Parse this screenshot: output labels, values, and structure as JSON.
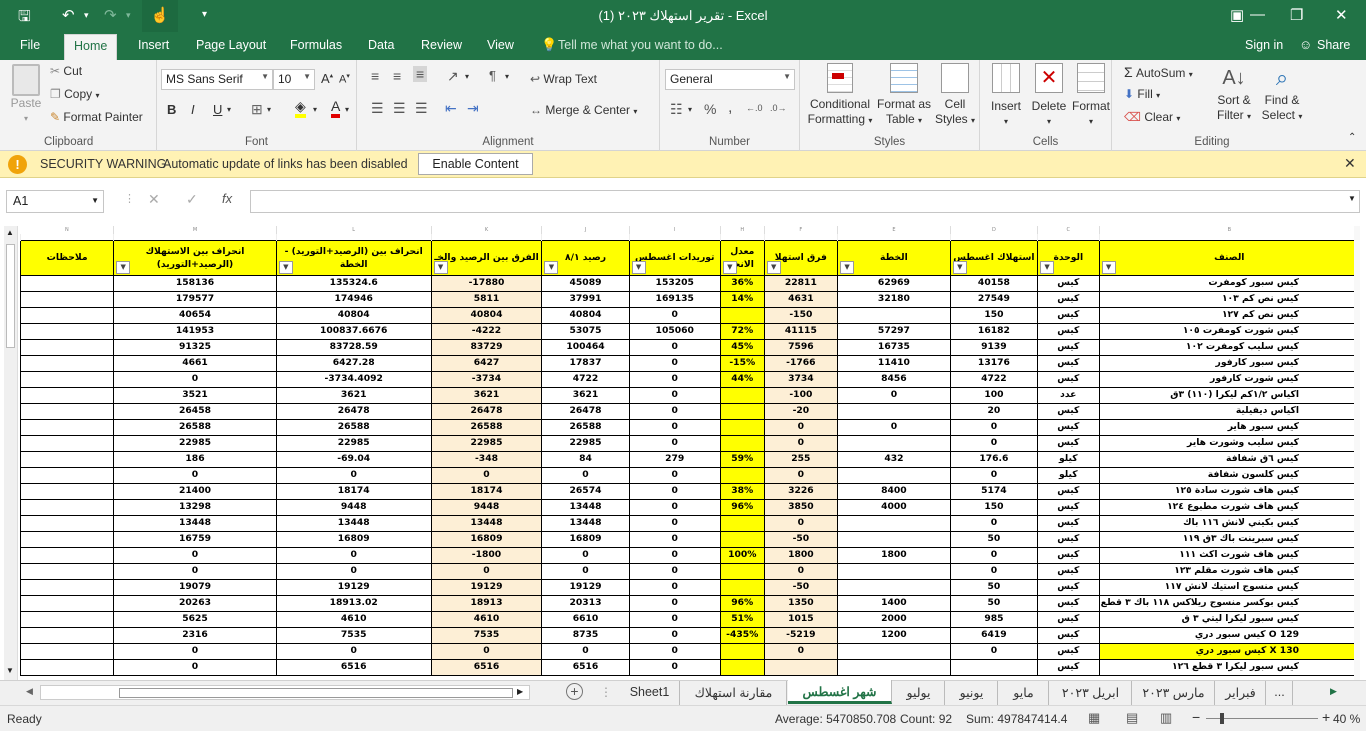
{
  "window": {
    "title": "تقرير استهلاك ٢٠٢٣ (1) - Excel"
  },
  "ribbon_tabs": [
    "File",
    "Home",
    "Insert",
    "Page Layout",
    "Formulas",
    "Data",
    "Review",
    "View"
  ],
  "tell_me": "Tell me what you want to do...",
  "account": {
    "signin": "Sign in",
    "share": "Share"
  },
  "clipboard": {
    "paste": "Paste",
    "cut": "Cut",
    "copy": "Copy",
    "format_painter": "Format Painter",
    "label": "Clipboard"
  },
  "font": {
    "name": "MS Sans Serif",
    "size": "10",
    "bold": "B",
    "italic": "I",
    "underline": "U",
    "label": "Font"
  },
  "alignment": {
    "wrap": "Wrap Text",
    "merge": "Merge & Center",
    "label": "Alignment"
  },
  "number": {
    "format": "General",
    "label": "Number"
  },
  "styles": {
    "cond": "Conditional",
    "cond2": "Formatting",
    "fmt_table": "Format as",
    "fmt_table2": "Table",
    "cell_styles": "Cell",
    "cell_styles2": "Styles",
    "label": "Styles"
  },
  "cells": {
    "insert": "Insert",
    "delete": "Delete",
    "format": "Format",
    "label": "Cells"
  },
  "editing": {
    "autosum": "AutoSum",
    "fill": "Fill",
    "clear": "Clear",
    "sort": "Sort &",
    "sort2": "Filter",
    "find": "Find &",
    "find2": "Select",
    "label": "Editing"
  },
  "security": {
    "title": "SECURITY WARNING",
    "message": "Automatic update of links has been disabled",
    "button": "Enable Content"
  },
  "namebox": "A1",
  "col_letters": [
    "N",
    "M",
    "L",
    "K",
    "J",
    "I",
    "H",
    "F",
    "E",
    "D",
    "C",
    "B"
  ],
  "headers": [
    "ملاحظات",
    "انحراف بين الاستهلاك (الرصيد+التوريد)",
    "انحراف بين (الرصيد+التوريد) - الخطة",
    "الفرق بين الرصيد والخـ",
    "رصيد ٨/١",
    "توريدات اغسطس",
    "معدل الانحـ",
    "فرق استهلا",
    "الخطة",
    "استهلاك اغسطس",
    "الوحدة",
    "الصنف"
  ],
  "rows": [
    [
      "",
      "158136",
      "135324.6",
      "-17880",
      "45089",
      "153205",
      "36%",
      "22811",
      "62969",
      "40158",
      "كيس",
      "كيس سبور كومفرت"
    ],
    [
      "",
      "179577",
      "174946",
      "5811",
      "37991",
      "169135",
      "14%",
      "4631",
      "32180",
      "27549",
      "كيس",
      "كيس نص كم ١٠٣"
    ],
    [
      "",
      "40654",
      "40804",
      "40804",
      "40804",
      "0",
      "",
      "-150",
      "",
      "150",
      "كيس",
      "كيس نص كم ١٢٧"
    ],
    [
      "",
      "141953",
      "100837.6676",
      "-4222",
      "53075",
      "105060",
      "72%",
      "41115",
      "57297",
      "16182",
      "كيس",
      "كيس شورت كومفرت ١٠٥"
    ],
    [
      "",
      "91325",
      "83728.59",
      "83729",
      "100464",
      "0",
      "45%",
      "7596",
      "16735",
      "9139",
      "كيس",
      "كيس سليب كومفرت ١٠٢"
    ],
    [
      "",
      "4661",
      "6427.28",
      "6427",
      "17837",
      "0",
      "-15%",
      "-1766",
      "11410",
      "13176",
      "كيس",
      "كيس سبور كارفور"
    ],
    [
      "",
      "0",
      "-3734.4092",
      "-3734",
      "4722",
      "0",
      "44%",
      "3734",
      "8456",
      "4722",
      "كيس",
      "كيس شورت كارفور"
    ],
    [
      "",
      "3521",
      "3621",
      "3621",
      "3621",
      "0",
      "",
      "-100",
      "0",
      "100",
      "عدد",
      "اكياس ١/٢كم ليكرا (١١٠) ٣ق"
    ],
    [
      "",
      "26458",
      "26478",
      "26478",
      "26478",
      "0",
      "",
      "-20",
      "",
      "20",
      "كيس",
      "اكياس ديفيلية"
    ],
    [
      "",
      "26588",
      "26588",
      "26588",
      "26588",
      "0",
      "",
      "0",
      "0",
      "0",
      "كيس",
      "كيس سبور هاير"
    ],
    [
      "",
      "22985",
      "22985",
      "22985",
      "22985",
      "0",
      "",
      "0",
      "",
      "0",
      "كيس",
      "كيس سليب وشورت هاير"
    ],
    [
      "",
      "186",
      "-69.04",
      "-348",
      "84",
      "279",
      "59%",
      "255",
      "432",
      "176.6",
      "كيلو",
      "كيس ٦ق شفافة"
    ],
    [
      "",
      "0",
      "0",
      "0",
      "0",
      "0",
      "",
      "0",
      "",
      "0",
      "كيلو",
      "كيس كلسون شفافة"
    ],
    [
      "",
      "21400",
      "18174",
      "18174",
      "26574",
      "0",
      "38%",
      "3226",
      "8400",
      "5174",
      "كيس",
      "كيس هاف شورت سادة ١٢٥"
    ],
    [
      "",
      "13298",
      "9448",
      "9448",
      "13448",
      "0",
      "96%",
      "3850",
      "4000",
      "150",
      "كيس",
      "كيس هاف شورت مطبوع ١٢٤"
    ],
    [
      "",
      "13448",
      "13448",
      "13448",
      "13448",
      "0",
      "",
      "0",
      "",
      "0",
      "كيس",
      "كيس بكيني لانش ١١٦ باك"
    ],
    [
      "",
      "16759",
      "16809",
      "16809",
      "16809",
      "0",
      "",
      "-50",
      "",
      "50",
      "كيس",
      "كيس سبرينت باك ٣ق ١١٩"
    ],
    [
      "",
      "0",
      "0",
      "-1800",
      "0",
      "0",
      "100%",
      "1800",
      "1800",
      "0",
      "كيس",
      "كيس هاف شورت اكث ١١١"
    ],
    [
      "",
      "0",
      "0",
      "0",
      "0",
      "0",
      "",
      "0",
      "",
      "0",
      "كيس",
      "كيس هاف شورت مقلم ١٢٣"
    ],
    [
      "",
      "19079",
      "19129",
      "19129",
      "19129",
      "0",
      "",
      "-50",
      "",
      "50",
      "كيس",
      "كيس منسوج استيك لانش ١١٧"
    ],
    [
      "",
      "20263",
      "18913.02",
      "18913",
      "20313",
      "0",
      "96%",
      "1350",
      "1400",
      "50",
      "كيس",
      "كيس بوكسر منسوج ريلاكس ١١٨ باك ٣ قطع"
    ],
    [
      "",
      "5625",
      "4610",
      "4610",
      "6610",
      "0",
      "51%",
      "1015",
      "2000",
      "985",
      "كيس",
      "كيس سبور ليكرا ليتي ٣ ق"
    ],
    [
      "",
      "2316",
      "7535",
      "7535",
      "8735",
      "0",
      "-435%",
      "-5219",
      "1200",
      "6419",
      "كيس",
      "كيس سبور دري O 129"
    ],
    [
      "",
      "0",
      "0",
      "0",
      "0",
      "0",
      "",
      "0",
      "",
      "0",
      "كيس",
      "كيس سبور دري X 130"
    ],
    [
      "",
      "0",
      "6516",
      "6516",
      "6516",
      "0",
      "",
      "",
      "",
      "",
      "كيس",
      "كيس سبور ليكرا ٣ قطع ١٢٦"
    ]
  ],
  "sheet_tabs": [
    "Sheet1",
    "مقارنة استهلاك",
    "شهر اغسطس",
    "يوليو",
    "يونيو",
    "مايو",
    "ابريل ٢٠٢٣",
    "مارس ٢٠٢٣",
    "فبراير",
    "..."
  ],
  "active_sheet": "شهر اغسطس",
  "status": {
    "ready": "Ready",
    "average": "Average: 5470850.708",
    "count": "Count: 92",
    "sum": "Sum: 497847414.4",
    "zoom": "40 %"
  }
}
